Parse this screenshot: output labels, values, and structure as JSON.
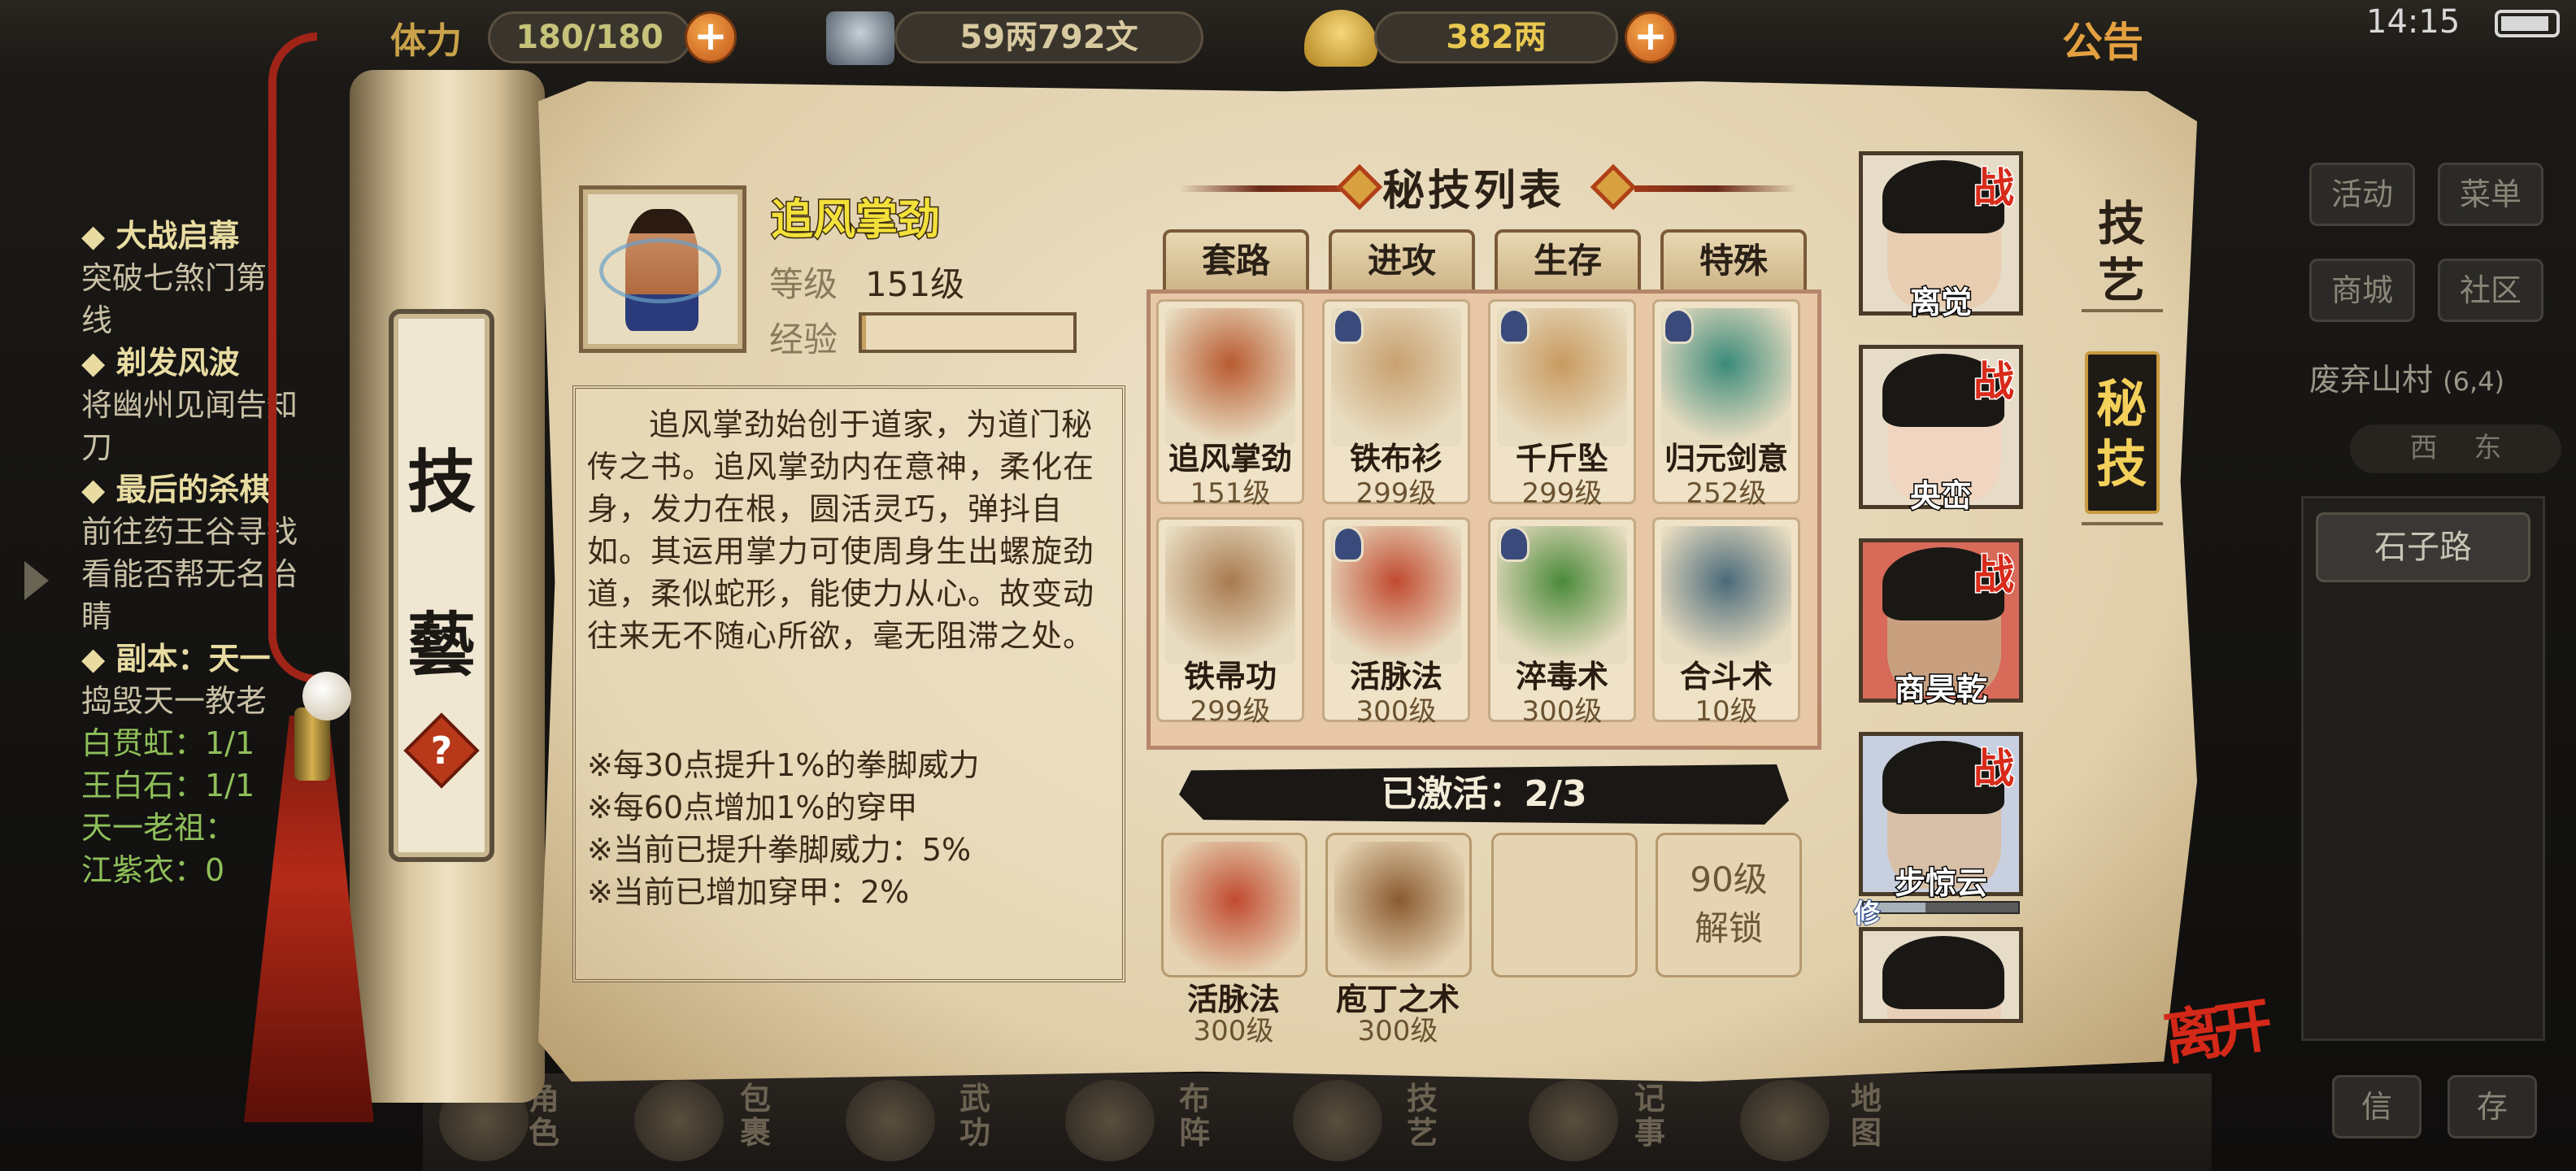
{
  "topbar": {
    "stamina_label": "体力",
    "stamina_value": "180/180",
    "silver": "59两792文",
    "gold": "382两",
    "announcement": "公告",
    "clock": "14:15"
  },
  "quests": [
    {
      "title": "大战启幕",
      "desc": [
        "突破七煞门第",
        "线"
      ]
    },
    {
      "title": "剃发风波",
      "desc": [
        "将幽州见闻告知",
        "刀"
      ]
    },
    {
      "title": "最后的杀棋",
      "desc": [
        "前往药王谷寻找",
        "看能否帮无名治",
        "睛"
      ]
    },
    {
      "title": "副本：天一",
      "desc": [
        "捣毁天一教老"
      ]
    }
  ],
  "quest_green": [
    "白贯虹：1/1",
    "王白石：1/1",
    "天一老祖：",
    "江紫衣：0"
  ],
  "right_panel": {
    "buttons": [
      "活动",
      "菜单",
      "商城",
      "社区"
    ],
    "location": "废弃山村",
    "coords": "(6,4)",
    "compass": "西  　东",
    "stone_path": "石子路",
    "bottom_buttons": [
      "信",
      "存"
    ]
  },
  "bottom_nav": [
    "角色",
    "包裹",
    "武功",
    "布阵",
    "技艺",
    "记事",
    "地图"
  ],
  "scroll_tab": {
    "char1": "技",
    "char2": "藝",
    "help": "?"
  },
  "skill": {
    "name": "追风掌劲",
    "level_label": "等级",
    "level_value": "151级",
    "exp_label": "经验",
    "exp_ratio": 0.02,
    "description": "追风掌劲始创于道家，为道门秘传之书。追风掌劲内在意神，柔化在身，发力在根，圆活灵巧，弹抖自如。其运用掌力可使周身生出螺旋劲道，柔似蛇形，能使力从心。故变动往来无不随心所欲，毫无阻滞之处。",
    "notes": [
      "※每30点提升1%的拳脚威力",
      "※每60点增加1%的穿甲",
      "※当前已提升拳脚威力：5%",
      "※当前已增加穿甲：2%"
    ]
  },
  "list_title": "秘技列表",
  "tabs": [
    "套路",
    "进攻",
    "生存",
    "特殊"
  ],
  "grid": [
    {
      "name": "追风掌劲",
      "level": "151级",
      "color": "#b85a30",
      "badge": false
    },
    {
      "name": "铁布衫",
      "level": "299级",
      "color": "#c8a070",
      "badge": true
    },
    {
      "name": "千斤坠",
      "level": "299级",
      "color": "#c89a60",
      "badge": true
    },
    {
      "name": "归元剑意",
      "level": "252级",
      "color": "#3a8a7a",
      "badge": true
    },
    {
      "name": "铁帚功",
      "level": "299级",
      "color": "#a87a50",
      "badge": false
    },
    {
      "name": "活脉法",
      "level": "300级",
      "color": "#c04a30",
      "badge": true
    },
    {
      "name": "淬毒术",
      "level": "300级",
      "color": "#4a8a3a",
      "badge": true
    },
    {
      "name": "合斗术",
      "level": "10级",
      "color": "#4a6a7a",
      "badge": false
    }
  ],
  "activated": "已激活：2/3",
  "slots": [
    {
      "name": "活脉法",
      "level": "300级",
      "color": "#c04a30"
    },
    {
      "name": "庖丁之术",
      "level": "300级",
      "color": "#8a5a30"
    }
  ],
  "lock_text": [
    "90级",
    "解锁"
  ],
  "characters": [
    {
      "name": "离觉",
      "battle": "战",
      "bg": "#e6dcc8",
      "face": "#e8cdb0"
    },
    {
      "name": "央峦",
      "battle": "战",
      "bg": "#e6dcc8",
      "face": "#f0d6c0"
    },
    {
      "name": "商昊乾",
      "battle": "战",
      "bg": "#d86a5a",
      "face": "#c8a080"
    },
    {
      "name": "步惊云",
      "battle": "战",
      "bg": "#c8d0e0",
      "face": "#d8c0a8"
    },
    {
      "name": "",
      "battle": "",
      "bg": "#e6dcc8",
      "face": "#e8d0b8"
    }
  ],
  "char_marker": "修",
  "vtabs": {
    "skill_art": [
      "技",
      "艺"
    ],
    "secret": [
      "秘",
      "技"
    ]
  },
  "leave": "离开",
  "colors": {
    "accent": "#f3e03a",
    "red": "#d42818",
    "paper": "#e6d6b4"
  }
}
